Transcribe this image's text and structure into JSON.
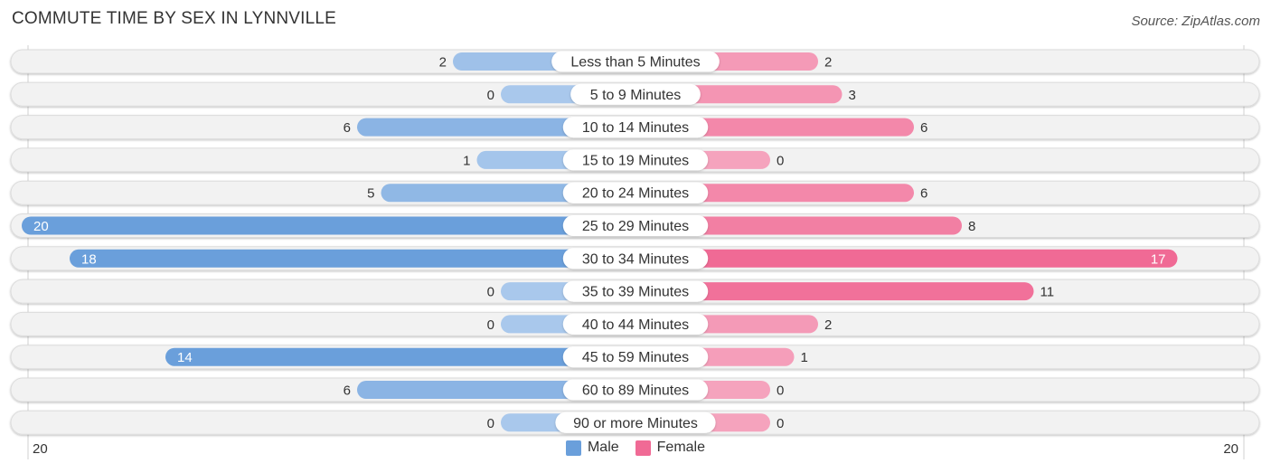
{
  "header": {
    "title": "COMMUTE TIME BY SEX IN LYNNVILLE",
    "source": "Source: ZipAtlas.com"
  },
  "colors": {
    "male_strong": "#6a9fdb",
    "male_light": "#a9c8ec",
    "female_strong": "#f06a95",
    "female_light": "#f5a3bd",
    "track": "#f2f2f2"
  },
  "chart_data": {
    "type": "bar",
    "orientation": "horizontal-diverging",
    "title": "COMMUTE TIME BY SEX IN LYNNVILLE",
    "categories": [
      "Less than 5 Minutes",
      "5 to 9 Minutes",
      "10 to 14 Minutes",
      "15 to 19 Minutes",
      "20 to 24 Minutes",
      "25 to 29 Minutes",
      "30 to 34 Minutes",
      "35 to 39 Minutes",
      "40 to 44 Minutes",
      "45 to 59 Minutes",
      "60 to 89 Minutes",
      "90 or more Minutes"
    ],
    "series": [
      {
        "name": "Male",
        "values": [
          2,
          0,
          6,
          1,
          5,
          20,
          18,
          0,
          0,
          14,
          6,
          0
        ]
      },
      {
        "name": "Female",
        "values": [
          2,
          3,
          6,
          0,
          6,
          8,
          17,
          11,
          2,
          1,
          0,
          0
        ]
      }
    ],
    "axis": {
      "left_label": "20",
      "right_label": "20",
      "max": 20
    },
    "legend": {
      "position": "bottom-center",
      "items": [
        "Male",
        "Female"
      ]
    }
  }
}
